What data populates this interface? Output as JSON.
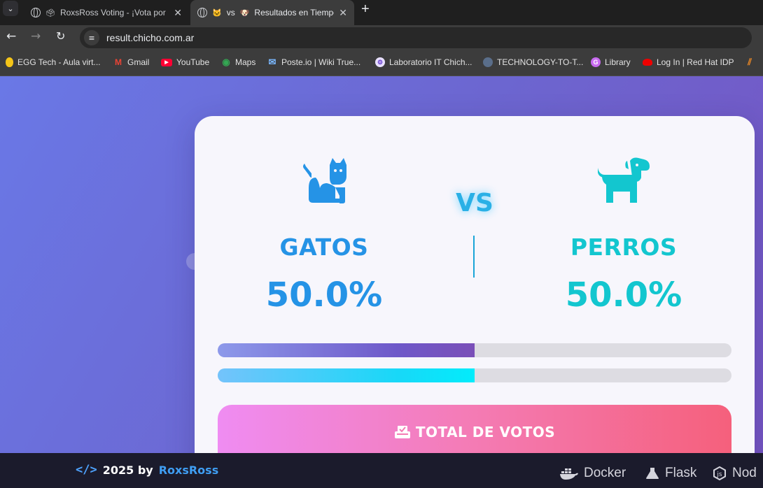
{
  "browser": {
    "tabs": [
      {
        "title": "RoxsRoss Voting - ¡Vota por",
        "active": false
      },
      {
        "title": "vs",
        "extra": "Resultados en Tiempo",
        "active": true
      }
    ],
    "url": "result.chicho.com.ar",
    "bookmarks": [
      {
        "label": "EGG Tech - Aula virt...",
        "icon": "egg-icon"
      },
      {
        "label": "Gmail",
        "icon": "gmail-icon"
      },
      {
        "label": "YouTube",
        "icon": "youtube-icon"
      },
      {
        "label": "Maps",
        "icon": "maps-icon"
      },
      {
        "label": "Poste.io | Wiki True...",
        "icon": "poste-icon"
      },
      {
        "label": "Laboratorio IT Chich...",
        "icon": "lab-icon"
      },
      {
        "label": "TECHNOLOGY-TO-T...",
        "icon": "tech-icon"
      },
      {
        "label": "Library",
        "icon": "library-icon"
      },
      {
        "label": "Log In | Red Hat IDP",
        "icon": "redhat-icon"
      }
    ]
  },
  "results": {
    "vs_label": "VS",
    "cat": {
      "name": "GATOS",
      "percent_text": "50.0%",
      "percent": 50.0,
      "color": "#2593e6"
    },
    "dog": {
      "name": "PERROS",
      "percent_text": "50.0%",
      "percent": 50.0,
      "color": "#13c6cf"
    },
    "total_label": "TOTAL DE VOTOS"
  },
  "footer": {
    "year_by": "2025 by",
    "author": "RoxsRoss",
    "tech": [
      "Docker",
      "Flask",
      "Nod"
    ]
  }
}
